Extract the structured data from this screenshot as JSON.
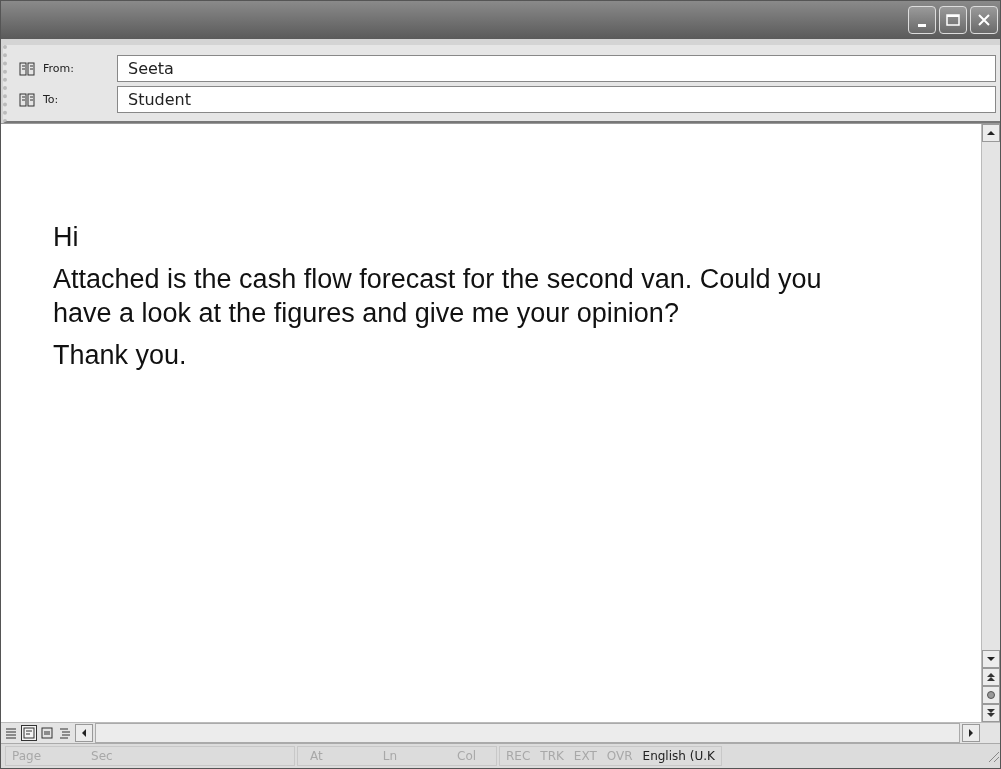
{
  "header": [
    {
      "label": "From:",
      "value": "Seeta"
    },
    {
      "label": "To:",
      "value": "Student"
    }
  ],
  "message": [
    "Hi",
    "Attached is the cash flow forecast for the second van. Could you have a look at the figures and give me your opinion?",
    "Thank you."
  ],
  "view_buttons": [
    {
      "kind": "normal",
      "selected": false
    },
    {
      "kind": "web",
      "selected": true
    },
    {
      "kind": "print",
      "selected": false
    },
    {
      "kind": "outline",
      "selected": false
    }
  ],
  "status_bar": [
    {
      "items": [
        {
          "text": "Page",
          "disabled": true
        },
        {
          "text": "Sec",
          "disabled": true
        }
      ]
    },
    {
      "items": [
        {
          "text": "At",
          "disabled": true
        },
        {
          "text": "Ln",
          "disabled": true
        },
        {
          "text": "Col",
          "disabled": true
        }
      ]
    },
    {
      "items": [
        {
          "text": "REC",
          "disabled": true
        },
        {
          "text": "TRK",
          "disabled": true
        },
        {
          "text": "EXT",
          "disabled": true
        },
        {
          "text": "OVR",
          "disabled": true
        },
        {
          "text": "English (U.K",
          "disabled": false
        }
      ]
    }
  ]
}
